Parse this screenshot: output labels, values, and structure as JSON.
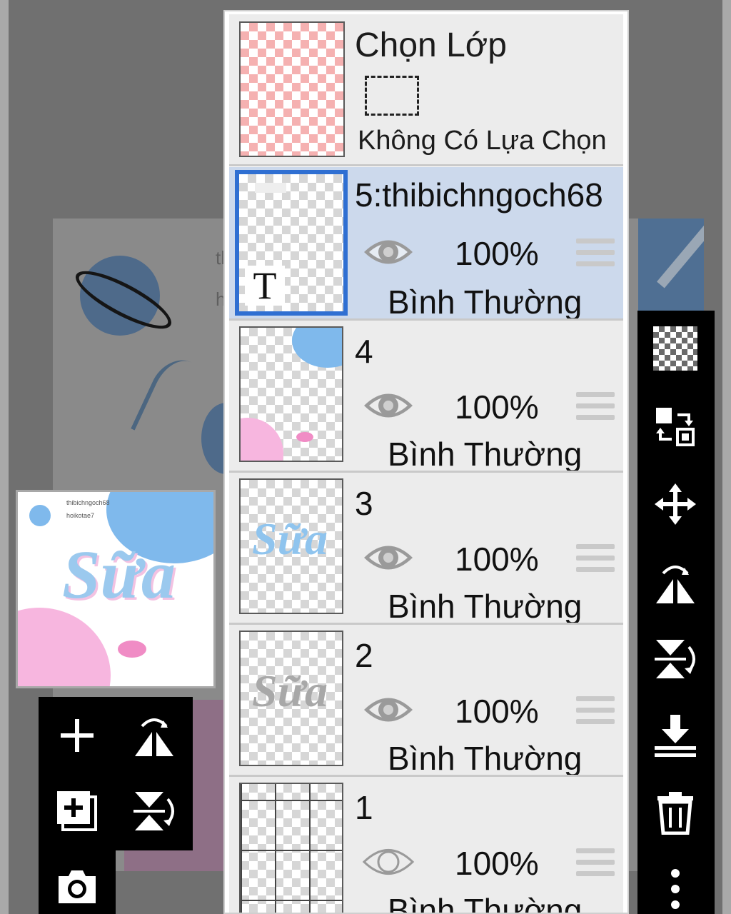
{
  "select_layer": {
    "title": "Chọn Lớp",
    "status": "Không Có Lựa Chọn"
  },
  "layers": [
    {
      "name": "5:thibichngoch68",
      "opacity": "100%",
      "blend": "Bình Thường",
      "visible": true,
      "selected": true,
      "type": "text",
      "badge": "T"
    },
    {
      "name": "4",
      "opacity": "100%",
      "blend": "Bình Thường",
      "visible": true,
      "selected": false
    },
    {
      "name": "3",
      "opacity": "100%",
      "blend": "Bình Thường",
      "visible": true,
      "selected": false
    },
    {
      "name": "2",
      "opacity": "100%",
      "blend": "Bình Thường",
      "visible": true,
      "selected": false
    },
    {
      "name": "1",
      "opacity": "100%",
      "blend": "Bình Thường",
      "visible": false,
      "selected": false
    }
  ],
  "artwork": {
    "word": "Sữa",
    "caption_line1": "thibichngoch68",
    "caption_line2": "hoikotae7",
    "bg_text_1": "th",
    "bg_text_2": "ho"
  },
  "right_toolbar": [
    "transparent-layer-icon",
    "swap-layers-icon",
    "move-icon",
    "flip-horizontal-icon",
    "flip-vertical-icon",
    "merge-down-icon",
    "delete-icon",
    "more-icon"
  ],
  "left_toolbar": [
    "add-layer-icon",
    "flip-horizontal-icon",
    "add-copy-icon",
    "flip-vertical-icon",
    "camera-icon"
  ],
  "colors": {
    "selected_row": "#ccd9ec",
    "selected_border": "#2f6fd2",
    "row_bg": "#ececec",
    "sky_blue": "#7fb9ec",
    "soft_pink": "#f7b6df"
  }
}
